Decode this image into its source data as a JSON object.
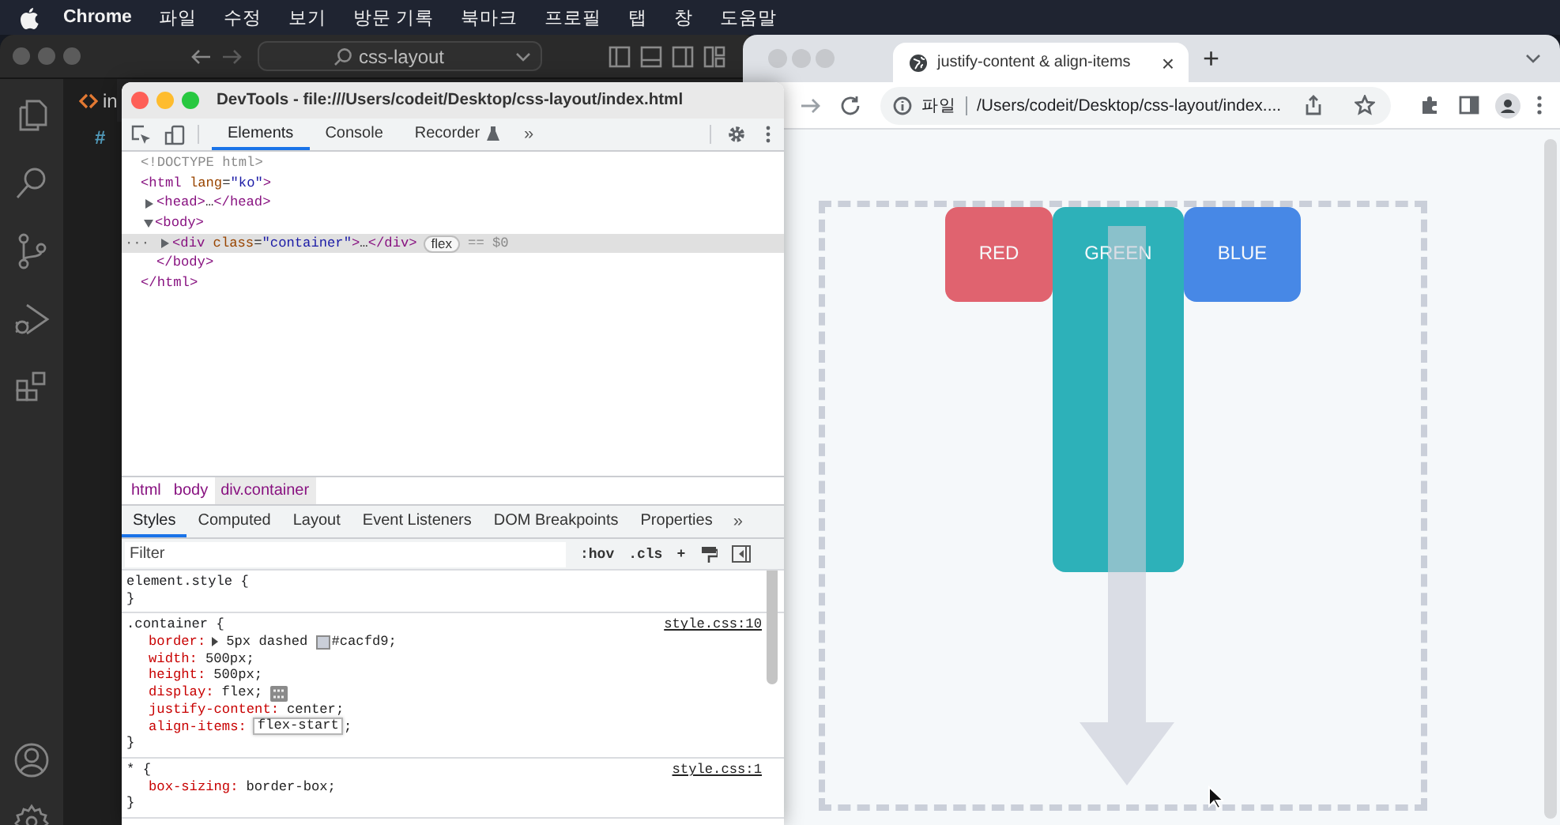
{
  "menu_bar": {
    "app": "Chrome",
    "items": [
      "파일",
      "수정",
      "보기",
      "방문 기록",
      "북마크",
      "프로필",
      "탭",
      "창",
      "도움말"
    ]
  },
  "editor_window": {
    "search": "css-layout",
    "tab": "in",
    "breadcrumb": "#"
  },
  "browser": {
    "tab": {
      "title": "justify-content & align-items",
      "close": "×"
    },
    "new_tab": "+",
    "address": {
      "scheme": "파일",
      "path": "/Users/codeit/Desktop/css-layout/index...."
    },
    "boxes": [
      {
        "label": "RED",
        "color": "#e0636f",
        "kind": "short"
      },
      {
        "label": "GREEN",
        "color": "#2db1b9",
        "kind": "tall"
      },
      {
        "label": "BLUE",
        "color": "#4788e6",
        "kind": "short"
      }
    ]
  },
  "devtools": {
    "title": "DevTools - file:///Users/codeit/Desktop/css-layout/index.html",
    "tabs": [
      {
        "label": "Elements",
        "selected": true
      },
      {
        "label": "Console",
        "selected": false
      },
      {
        "label": "Recorder",
        "selected": false
      }
    ],
    "more_tabs": "»",
    "dom_tree": [
      {
        "tokens": [
          {
            "kind": "comment",
            "text": "<!DOCTYPE html>"
          }
        ],
        "selected": false
      },
      {
        "tokens": [
          {
            "kind": "tag",
            "text": "<html"
          },
          {
            "kind": "attr",
            "text": " lang"
          },
          {
            "kind": "plain",
            "text": "="
          },
          {
            "kind": "value",
            "text": "\"ko\""
          },
          {
            "kind": "tag",
            "text": ">"
          }
        ],
        "selected": false,
        "children": [
          {
            "tokens": [
              {
                "kind": "tag",
                "text": "<head>"
              },
              {
                "kind": "plain",
                "text": "…"
              },
              {
                "kind": "tag",
                "text": "</head>"
              }
            ],
            "expanded": false,
            "selected": false
          },
          {
            "tokens": [
              {
                "kind": "tag",
                "text": "<body>"
              }
            ],
            "expanded": true,
            "selected": false,
            "children": [
              {
                "gutter": "···",
                "tokens": [
                  {
                    "kind": "tag",
                    "text": "<div"
                  },
                  {
                    "kind": "attr",
                    "text": " class"
                  },
                  {
                    "kind": "plain",
                    "text": "="
                  },
                  {
                    "kind": "value",
                    "text": "\"container\""
                  },
                  {
                    "kind": "tag",
                    "text": ">"
                  },
                  {
                    "kind": "plain",
                    "text": "…"
                  },
                  {
                    "kind": "tag",
                    "text": "</div>"
                  }
                ],
                "badge": "flex",
                "suffix": "== $0",
                "expanded": false,
                "selected": true
              }
            ],
            "closing": [
              {
                "kind": "tag",
                "text": "</body>"
              }
            ]
          }
        ],
        "closing": [
          {
            "kind": "tag",
            "text": "</html>"
          }
        ]
      }
    ],
    "breadcrumbs": [
      {
        "label": "html",
        "selected": false
      },
      {
        "label": "body",
        "selected": false
      },
      {
        "label": "div.container",
        "selected": true
      }
    ],
    "style_tabs": [
      {
        "label": "Styles",
        "selected": true
      },
      {
        "label": "Computed",
        "selected": false
      },
      {
        "label": "Layout",
        "selected": false
      },
      {
        "label": "Event Listeners",
        "selected": false
      },
      {
        "label": "DOM Breakpoints",
        "selected": false
      },
      {
        "label": "Properties",
        "selected": false
      }
    ],
    "more_style_tabs": "»",
    "filter": {
      "placeholder": "Filter"
    },
    "filter_buttons": [
      ":hov",
      ".cls",
      "+"
    ],
    "rules": [
      {
        "selector": "element.style {",
        "close": "}"
      },
      {
        "selector": ".container {",
        "source": "style.css:10",
        "declarations": [
          {
            "name": "border:",
            "value": "5px dashed",
            "color": "#cacfd9",
            "value_after": "#cacfd9;",
            "expandable": true,
            "editing": false,
            "flex_editor": false
          },
          {
            "name": "width:",
            "value": "500px;",
            "expandable": false,
            "editing": false,
            "flex_editor": false
          },
          {
            "name": "height:",
            "value": "500px;",
            "expandable": false,
            "editing": false,
            "flex_editor": false
          },
          {
            "name": "display:",
            "value": "flex;",
            "expandable": false,
            "editing": false,
            "flex_editor": true
          },
          {
            "name": "justify-content:",
            "value": "center;",
            "expandable": false,
            "editing": false,
            "flex_editor": false
          },
          {
            "name": "align-items:",
            "value": "flex-start",
            "value_after": ";",
            "expandable": false,
            "editing": true,
            "flex_editor": false
          }
        ],
        "close": "}"
      },
      {
        "selector": "* {",
        "source": "style.css:1",
        "declarations": [
          {
            "name": "box-sizing:",
            "value": "border-box;",
            "expandable": false,
            "editing": false,
            "flex_editor": false
          }
        ],
        "close": "}"
      }
    ]
  }
}
